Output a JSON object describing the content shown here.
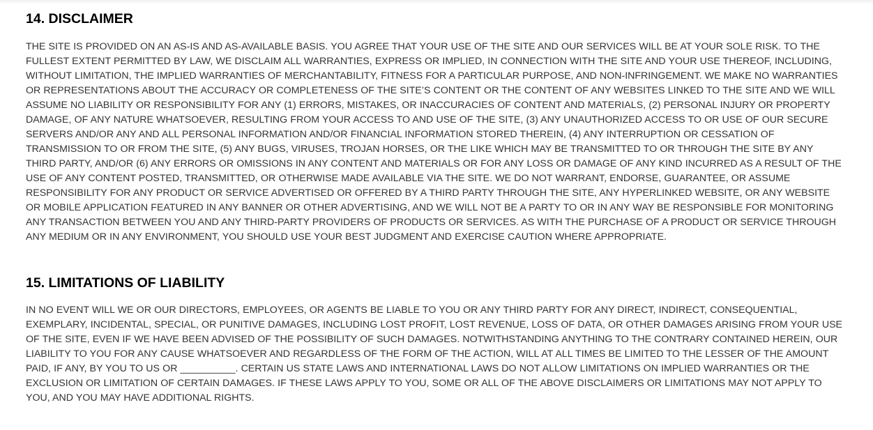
{
  "sections": [
    {
      "heading": "14. DISCLAIMER",
      "body": "THE SITE IS PROVIDED ON AN AS-IS AND AS-AVAILABLE BASIS. YOU AGREE THAT YOUR USE OF THE SITE AND OUR SERVICES WILL BE AT YOUR SOLE RISK. TO THE FULLEST EXTENT PERMITTED BY LAW, WE DISCLAIM ALL WARRANTIES, EXPRESS OR IMPLIED, IN CONNECTION WITH THE SITE AND YOUR USE THEREOF, INCLUDING, WITHOUT LIMITATION, THE IMPLIED WARRANTIES OF MERCHANTABILITY, FITNESS FOR A PARTICULAR PURPOSE, AND NON-INFRINGEMENT. WE MAKE NO WARRANTIES OR REPRESENTATIONS ABOUT THE ACCURACY OR COMPLETENESS OF THE SITE’S CONTENT OR THE CONTENT OF ANY WEBSITES LINKED TO THE SITE AND WE WILL ASSUME NO LIABILITY OR RESPONSIBILITY FOR ANY (1) ERRORS, MISTAKES, OR INACCURACIES OF CONTENT AND MATERIALS, (2) PERSONAL INJURY OR PROPERTY DAMAGE, OF ANY NATURE WHATSOEVER, RESULTING FROM YOUR ACCESS TO AND USE OF THE SITE, (3) ANY UNAUTHORIZED ACCESS TO OR USE OF OUR SECURE SERVERS AND/OR ANY AND ALL PERSONAL INFORMATION AND/OR FINANCIAL INFORMATION STORED THEREIN, (4) ANY INTERRUPTION OR CESSATION OF TRANSMISSION TO OR FROM THE SITE, (5) ANY BUGS, VIRUSES, TROJAN HORSES, OR THE LIKE WHICH MAY BE TRANSMITTED TO OR THROUGH THE SITE BY ANY THIRD PARTY, AND/OR (6) ANY ERRORS OR OMISSIONS IN ANY CONTENT AND MATERIALS OR FOR ANY LOSS OR DAMAGE OF ANY KIND INCURRED AS A RESULT OF THE USE OF ANY CONTENT POSTED, TRANSMITTED, OR OTHERWISE MADE AVAILABLE VIA THE SITE. WE DO NOT WARRANT, ENDORSE, GUARANTEE, OR ASSUME RESPONSIBILITY FOR ANY PRODUCT OR SERVICE ADVERTISED OR OFFERED BY A THIRD PARTY THROUGH THE SITE, ANY HYPERLINKED WEBSITE, OR ANY WEBSITE OR MOBILE APPLICATION FEATURED IN ANY BANNER OR OTHER ADVERTISING, AND WE WILL NOT BE A PARTY TO OR IN ANY WAY BE RESPONSIBLE FOR MONITORING ANY TRANSACTION BETWEEN YOU AND ANY THIRD-PARTY PROVIDERS OF PRODUCTS OR SERVICES. AS WITH THE PURCHASE OF A PRODUCT OR SERVICE THROUGH ANY MEDIUM OR IN ANY ENVIRONMENT, YOU SHOULD USE YOUR BEST JUDGMENT AND EXERCISE CAUTION WHERE APPROPRIATE."
    },
    {
      "heading": "15. LIMITATIONS OF LIABILITY",
      "body": "IN NO EVENT WILL WE OR OUR DIRECTORS, EMPLOYEES, OR AGENTS BE LIABLE TO YOU OR ANY THIRD PARTY FOR ANY DIRECT, INDIRECT, CONSEQUENTIAL, EXEMPLARY, INCIDENTAL, SPECIAL, OR PUNITIVE DAMAGES, INCLUDING LOST PROFIT, LOST REVENUE, LOSS OF DATA, OR OTHER DAMAGES ARISING FROM YOUR USE OF THE SITE, EVEN IF WE HAVE BEEN ADVISED OF THE POSSIBILITY OF SUCH DAMAGES. NOTWITHSTANDING ANYTHING TO THE CONTRARY CONTAINED HEREIN, OUR LIABILITY TO YOU FOR ANY CAUSE WHATSOEVER AND REGARDLESS OF THE FORM OF THE ACTION, WILL AT ALL TIMES BE LIMITED TO THE LESSER OF THE AMOUNT PAID, IF ANY, BY YOU TO US OR __________. CERTAIN US STATE LAWS AND INTERNATIONAL LAWS DO NOT ALLOW LIMITATIONS ON IMPLIED WARRANTIES OR THE EXCLUSION OR LIMITATION OF CERTAIN DAMAGES. IF THESE LAWS APPLY TO YOU, SOME OR ALL OF THE ABOVE DISCLAIMERS OR LIMITATIONS MAY NOT APPLY TO YOU, AND YOU MAY HAVE ADDITIONAL RIGHTS."
    }
  ]
}
